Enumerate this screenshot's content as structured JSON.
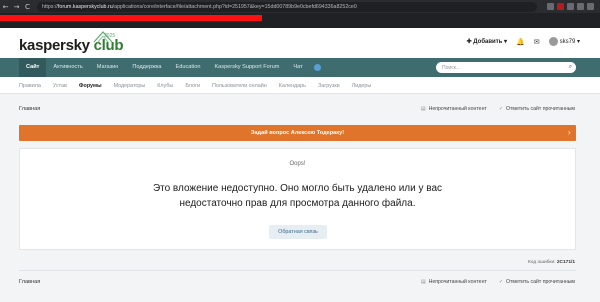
{
  "browser": {
    "nav_back": "←",
    "nav_forward": "→",
    "nav_reload": "C",
    "url_scheme": "https://",
    "url_host": "forum.kasperskyclub.ru",
    "url_path": "/applications/core/interface/file/attachment.php?id=251957&key=15dd00789b9e0cbefd694336a8252ce0"
  },
  "header": {
    "logo_main": "kaspersky",
    "logo_club": " club",
    "logo_year": "2025",
    "add_label": "✚ Добавить ▾",
    "bell_icon": "🔔",
    "mail_icon": "✉",
    "user_name": "sks79 ▾"
  },
  "primary_nav": {
    "items": [
      "Сайт",
      "Активность",
      "Магазин",
      "Поддержка",
      "Education",
      "Kaspersky Support Forum",
      "Чат"
    ],
    "search_placeholder": "Поиск..."
  },
  "secondary_nav": {
    "items": [
      "Правила",
      "Устав",
      "Форумы",
      "Модераторы",
      "Клубы",
      "Блоги",
      "Пользователи онлайн",
      "Календарь",
      "Загрузки",
      "Лидеры"
    ]
  },
  "breadcrumb": {
    "home": "Главная",
    "unread": "Непрочитанный контент",
    "mark_read": "Отметить сайт прочитанным"
  },
  "banner": {
    "text": "Задай вопрос Алексею Тодераку!",
    "chevron": "›"
  },
  "error": {
    "oops": "Oops!",
    "message": "Это вложение недоступно. Оно могло быть удалено или у вас недостаточно прав для просмотра данного файла.",
    "contact": "Обратная связь",
    "code_label": "Код ошибки: ",
    "code_value": "2C171/1"
  },
  "footer_breadcrumb": {
    "home": "Главная",
    "unread": "Непрочитанный контент",
    "mark_read": "Отметить сайт прочитанным"
  },
  "colors": {
    "nav_bg": "#3e6c6f",
    "banner": "#e1742b",
    "logo_green": "#2e7d32"
  }
}
